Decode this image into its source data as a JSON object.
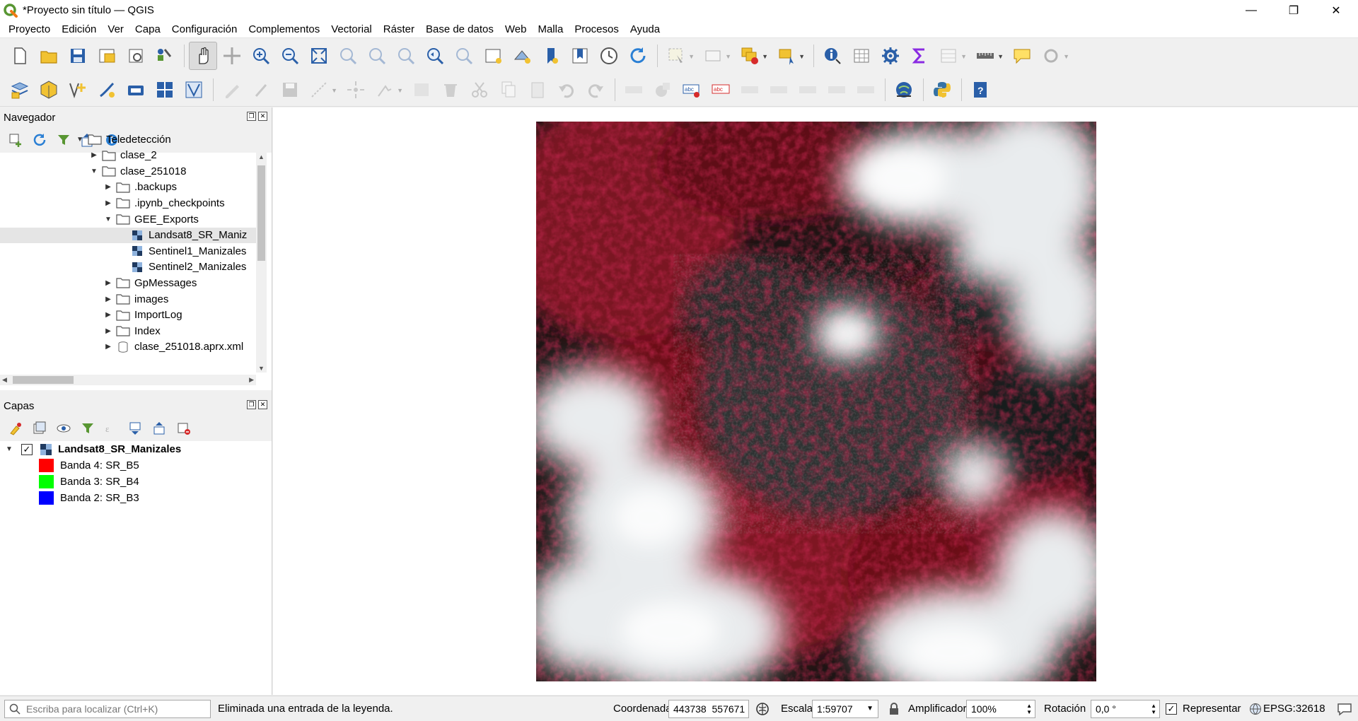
{
  "window": {
    "title": "*Proyecto sin título — QGIS"
  },
  "menu": [
    "Proyecto",
    "Edición",
    "Ver",
    "Capa",
    "Configuración",
    "Complementos",
    "Vectorial",
    "Ráster",
    "Base de datos",
    "Web",
    "Malla",
    "Procesos",
    "Ayuda"
  ],
  "browser": {
    "title": "Navegador",
    "items": [
      {
        "label": "Teledetección",
        "depth": 0,
        "expanded": true,
        "kind": "folder"
      },
      {
        "label": "clase_2",
        "depth": 1,
        "expanded": false,
        "kind": "folder"
      },
      {
        "label": "clase_251018",
        "depth": 1,
        "expanded": true,
        "kind": "folder"
      },
      {
        "label": ".backups",
        "depth": 2,
        "expanded": false,
        "kind": "folder"
      },
      {
        "label": ".ipynb_checkpoints",
        "depth": 2,
        "expanded": false,
        "kind": "folder"
      },
      {
        "label": "GEE_Exports",
        "depth": 2,
        "expanded": true,
        "kind": "folder"
      },
      {
        "label": "Landsat8_SR_Maniz",
        "depth": 3,
        "kind": "raster",
        "selected": true
      },
      {
        "label": "Sentinel1_Manizales",
        "depth": 3,
        "kind": "raster"
      },
      {
        "label": "Sentinel2_Manizales",
        "depth": 3,
        "kind": "raster"
      },
      {
        "label": "GpMessages",
        "depth": 2,
        "expanded": false,
        "kind": "folder"
      },
      {
        "label": "images",
        "depth": 2,
        "expanded": false,
        "kind": "folder"
      },
      {
        "label": "ImportLog",
        "depth": 2,
        "expanded": false,
        "kind": "folder"
      },
      {
        "label": "Index",
        "depth": 2,
        "expanded": false,
        "kind": "folder"
      },
      {
        "label": "clase_251018.aprx.xml",
        "depth": 2,
        "expanded": false,
        "kind": "database"
      }
    ]
  },
  "layers": {
    "title": "Capas",
    "layer_name": "Landsat8_SR_Manizales",
    "bands": [
      {
        "label": "Banda 4: SR_B5",
        "color": "#ff0000"
      },
      {
        "label": "Banda 3: SR_B4",
        "color": "#00ff00"
      },
      {
        "label": "Banda 2: SR_B3",
        "color": "#0000ff"
      }
    ]
  },
  "status": {
    "search_placeholder": "Escriba para localizar (Ctrl+K)",
    "message": "Eliminada una entrada de la leyenda.",
    "coord_label": "Coordenada",
    "coord_value": "443738  557671",
    "scale_label": "Escala",
    "scale_value": "1:59707",
    "magnifier_label": "Amplificador",
    "magnifier_value": "100%",
    "rotation_label": "Rotación",
    "rotation_value": "0,0 °",
    "render_label": "Representar",
    "crs": "EPSG:32618"
  },
  "colors": {
    "accent": "#589632",
    "raster_red": "#8b0f1e",
    "cloud": "#e8ecef"
  }
}
